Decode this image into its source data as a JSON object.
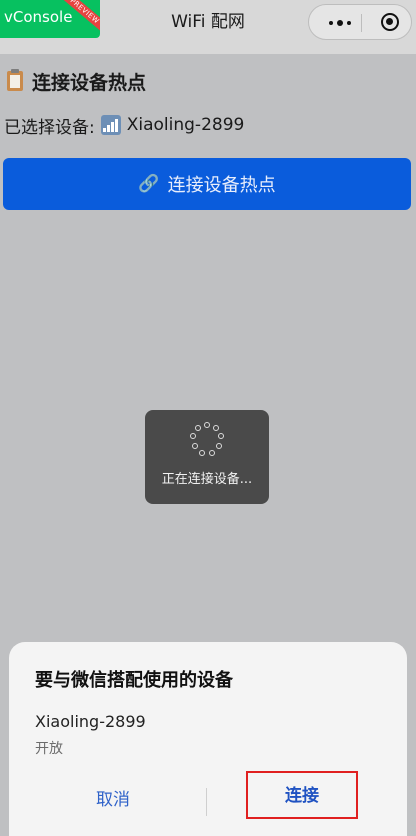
{
  "nav": {
    "vconsole_label": "vConsole",
    "preview_badge": "PREVIEW",
    "title": "WiFi 配网"
  },
  "content": {
    "section_title": "连接设备热点",
    "section_icon": "clipboard-icon",
    "selected_prefix": "已选择设备:",
    "selected_device": "Xiaoling-2899",
    "connect_button": "连接设备热点",
    "connect_icon": "link-icon"
  },
  "loading": {
    "text": "正在连接设备..."
  },
  "sheet": {
    "title": "要与微信搭配使用的设备",
    "device_name": "Xiaoling-2899",
    "security": "开放",
    "cancel_label": "取消",
    "connect_label": "连接"
  },
  "colors": {
    "primary": "#0a5cdc",
    "vconsole": "#07c160",
    "highlight": "#e02020"
  }
}
